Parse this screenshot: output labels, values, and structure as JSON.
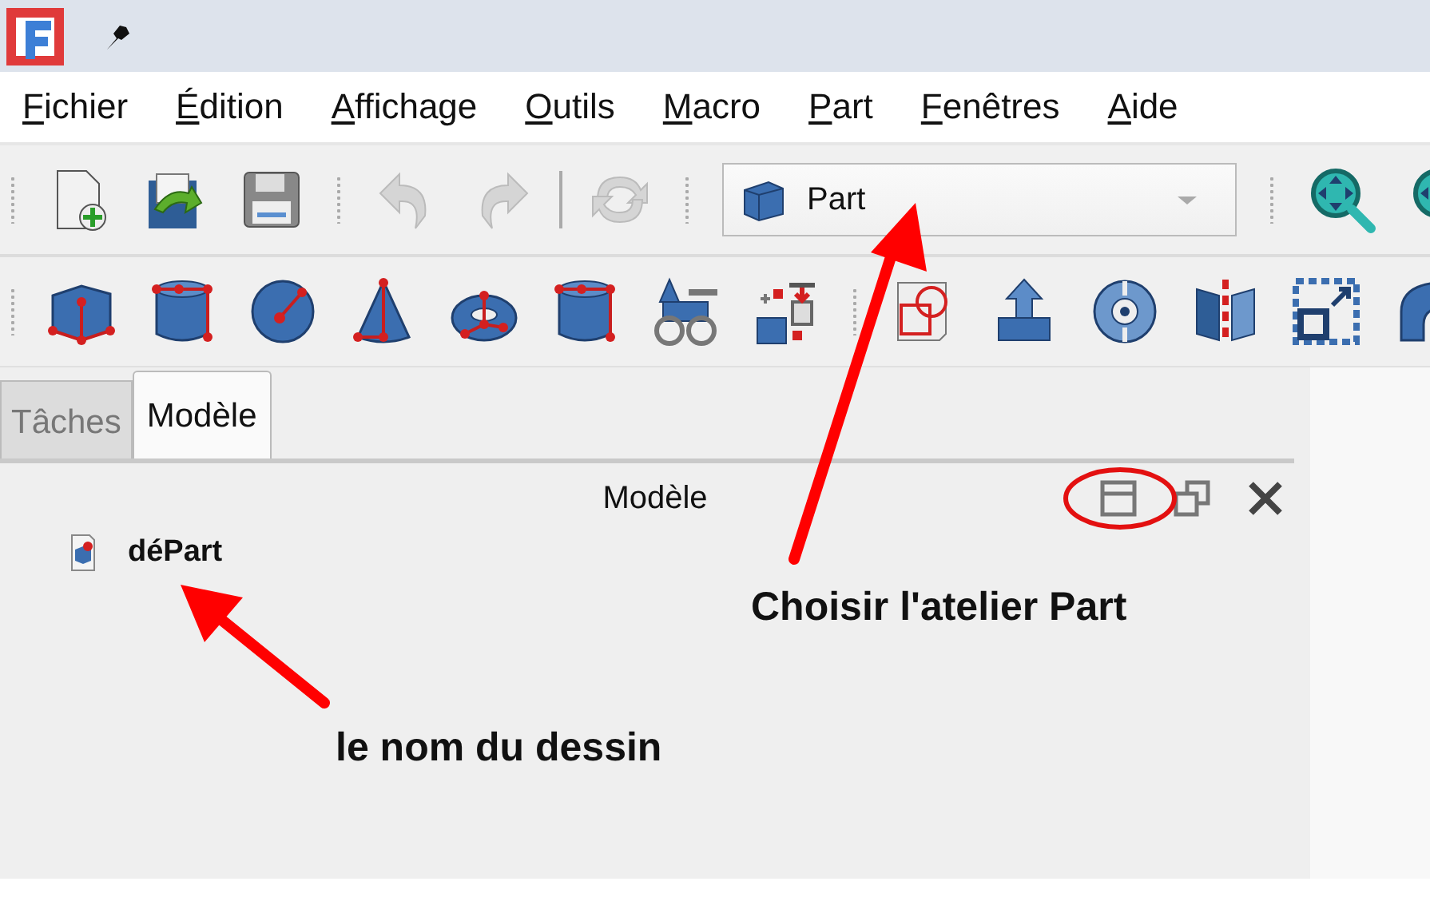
{
  "menu": [
    "Fichier",
    "Édition",
    "Affichage",
    "Outils",
    "Macro",
    "Part",
    "Fenêtres",
    "Aide"
  ],
  "file_toolbar": [
    {
      "kind": "new",
      "disabled": false
    },
    {
      "kind": "open",
      "disabled": false
    },
    {
      "kind": "save",
      "disabled": false
    },
    {
      "kind": "undo",
      "disabled": true
    },
    {
      "kind": "redo",
      "disabled": true
    },
    {
      "kind": "refresh",
      "disabled": true
    }
  ],
  "workbench_selector": {
    "value": "Part"
  },
  "view_toolbar": [
    {
      "kind": "zoom"
    },
    {
      "kind": "zoom"
    }
  ],
  "part_toolbar": [
    {
      "kind": "cube"
    },
    {
      "kind": "cylinder"
    },
    {
      "kind": "sphere"
    },
    {
      "kind": "cone"
    },
    {
      "kind": "torus"
    },
    {
      "kind": "tube"
    },
    {
      "kind": "primitives"
    },
    {
      "kind": "builder"
    },
    {
      "kind": "sketch"
    },
    {
      "kind": "extrude"
    },
    {
      "kind": "revolve"
    },
    {
      "kind": "mirror"
    },
    {
      "kind": "offset"
    },
    {
      "kind": "curved"
    }
  ],
  "tabs": [
    {
      "label": "Tâches",
      "selected": false
    },
    {
      "label": "Modèle",
      "selected": true
    }
  ],
  "panel": {
    "title": "Modèle",
    "tree": [
      {
        "label": "déPart"
      }
    ]
  },
  "annotations": [
    {
      "text": "Choisir l'atelier Part"
    },
    {
      "text": "le nom du dessin"
    }
  ]
}
